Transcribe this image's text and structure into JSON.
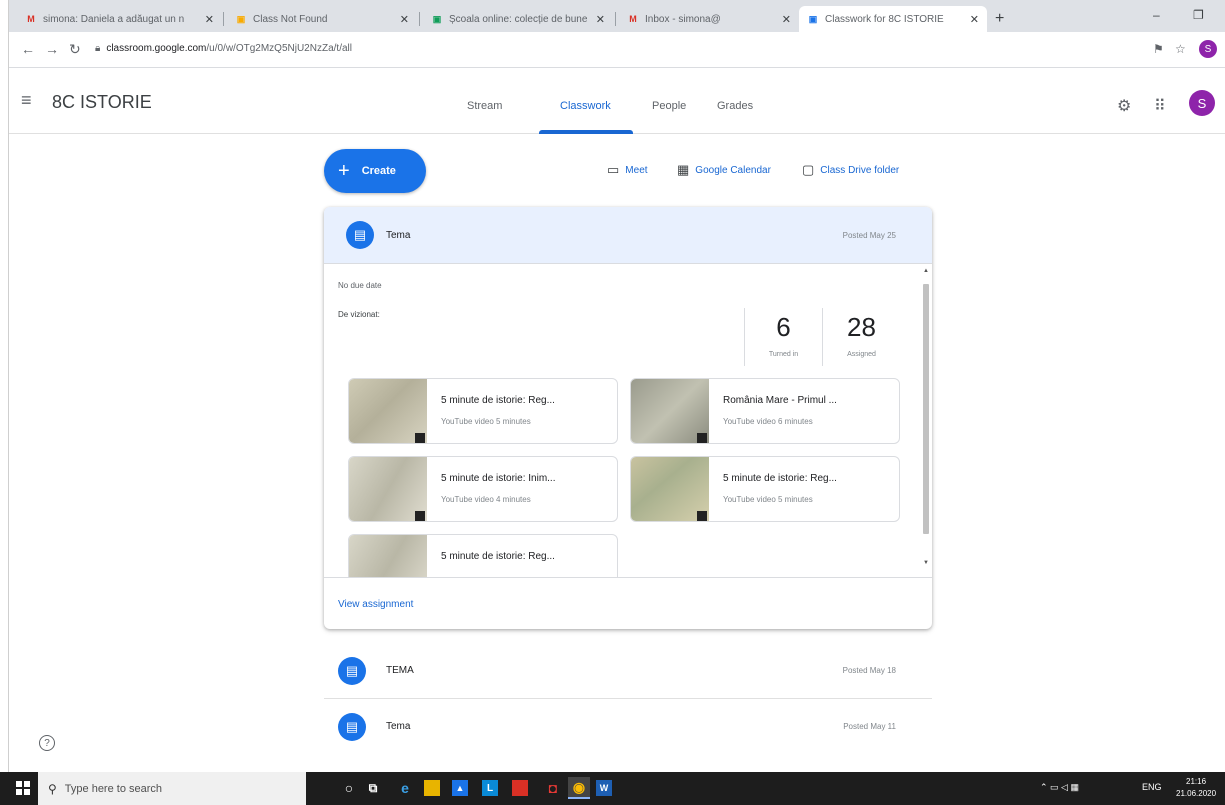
{
  "browser": {
    "tabs": [
      {
        "label": "simona: Daniela a adăugat un n",
        "favicon": "M",
        "favicon_color": "#d93025"
      },
      {
        "label": "Class Not Found",
        "favicon": "▣",
        "favicon_color": "#f9ab00"
      },
      {
        "label": "Școala online: colecție de bune",
        "favicon": "▣",
        "favicon_color": "#0f9d58"
      },
      {
        "label": "Inbox - simona@",
        "favicon": "M",
        "favicon_color": "#d93025"
      },
      {
        "label": "Classwork for 8C ISTORIE",
        "favicon": "▣",
        "favicon_color": "#1a73e8"
      }
    ],
    "url_host": "classroom.google.com",
    "url_path": "/u/0/w/OTg2MzQ5NjU2NzZa/t/all",
    "profile_initial": "S"
  },
  "header": {
    "class_name": "8C ISTORIE",
    "tabs": [
      "Stream",
      "Classwork",
      "People",
      "Grades"
    ],
    "active_tab": "Classwork",
    "avatar_initial": "S"
  },
  "toolbar": {
    "create_label": "Create",
    "meet_label": "Meet",
    "calendar_label": "Google Calendar",
    "drive_label": "Class Drive folder"
  },
  "assignment": {
    "title": "Tema",
    "posted": "Posted May 25",
    "due": "No due date",
    "description": "De vizionat:",
    "turned_in": "6",
    "turned_in_label": "Turned in",
    "assigned": "28",
    "assigned_label": "Assigned",
    "attachments": [
      {
        "title": "5 minute de istorie: Reg...",
        "meta": "YouTube video 5 minutes"
      },
      {
        "title": "România Mare - Primul ...",
        "meta": "YouTube video 6 minutes"
      },
      {
        "title": "5 minute de istorie: Inim...",
        "meta": "YouTube video 4 minutes"
      },
      {
        "title": "5 minute de istorie: Reg...",
        "meta": "YouTube video 5 minutes"
      },
      {
        "title": "5 minute de istorie: Reg...",
        "meta": ""
      }
    ],
    "view_link": "View assignment"
  },
  "list": [
    {
      "title": "TEMA",
      "posted": "Posted May 18"
    },
    {
      "title": "Tema",
      "posted": "Posted May 11"
    }
  ],
  "taskbar": {
    "search_placeholder": "Type here to search",
    "lang": "ENG",
    "time": "21:16",
    "date": "21.06.2020"
  },
  "colors": {
    "accent": "#1a73e8",
    "card_header": "#e8f0fe",
    "avatar": "#8e24aa"
  }
}
